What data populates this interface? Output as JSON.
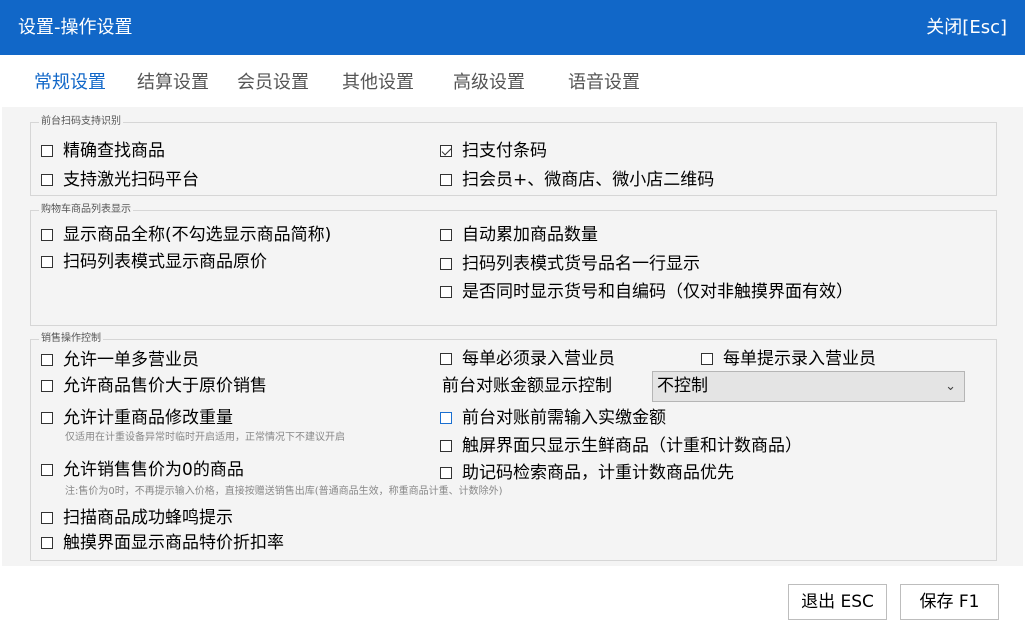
{
  "window": {
    "title": "设置-操作设置",
    "close_label": "关闭[Esc]"
  },
  "tabs": [
    {
      "label": "常规设置",
      "active": true
    },
    {
      "label": "结算设置",
      "active": false
    },
    {
      "label": "会员设置",
      "active": false
    },
    {
      "label": "其他设置",
      "active": false
    },
    {
      "label": "高级设置",
      "active": false
    },
    {
      "label": "语音设置",
      "active": false
    }
  ],
  "group_scan": {
    "legend": "前台扫码支持识别",
    "items": [
      {
        "label": "精确查找商品",
        "checked": false
      },
      {
        "label": "扫支付条码",
        "checked": true
      },
      {
        "label": "支持激光扫码平台",
        "checked": false
      },
      {
        "label": "扫会员+、微商店、微小店二维码",
        "checked": false
      }
    ]
  },
  "group_cart": {
    "legend": "购物车商品列表显示",
    "items": [
      {
        "label": "显示商品全称(不勾选显示商品简称)",
        "checked": false
      },
      {
        "label": "自动累加商品数量",
        "checked": false
      },
      {
        "label": "扫码列表模式显示商品原价",
        "checked": false
      },
      {
        "label": "扫码列表模式货号品名一行显示",
        "checked": false
      },
      {
        "label": "是否同时显示货号和自编码（仅对非触摸界面有效）",
        "checked": false
      }
    ]
  },
  "group_sales": {
    "legend": "销售操作控制",
    "items": [
      {
        "label": "允许一单多营业员",
        "checked": false
      },
      {
        "label": "每单必须录入营业员",
        "checked": false
      },
      {
        "label": "每单提示录入营业员",
        "checked": false
      },
      {
        "label": "允许商品售价大于原价销售",
        "checked": false
      },
      {
        "label": "允许计重商品修改重量",
        "checked": false
      },
      {
        "label": "前台对账前需输入实缴金额",
        "checked": false
      },
      {
        "label": "触屏界面只显示生鲜商品（计重和计数商品）",
        "checked": false
      },
      {
        "label": "允许销售售价为0的商品",
        "checked": false
      },
      {
        "label": "助记码检索商品，计重计数商品优先",
        "checked": false
      },
      {
        "label": "扫描商品成功蜂鸣提示",
        "checked": false
      },
      {
        "label": "触摸界面显示商品特价折扣率",
        "checked": false
      }
    ],
    "note_weight": "仅适用在计重设备异常时临时开启适用，正常情况下不建议开启",
    "note_zero_price": "注:售价为0时，不再提示输入价格，直接按赠送销售出库(普通商品生效，称重商品计重、计数除外)",
    "amount_control_label": "前台对账金额显示控制",
    "amount_control_value": "不控制"
  },
  "footer": {
    "exit_label": "退出 ESC",
    "save_label": "保存 F1"
  },
  "colors": {
    "accent": "#1167c8",
    "panel_bg": "#f4f4f4"
  }
}
